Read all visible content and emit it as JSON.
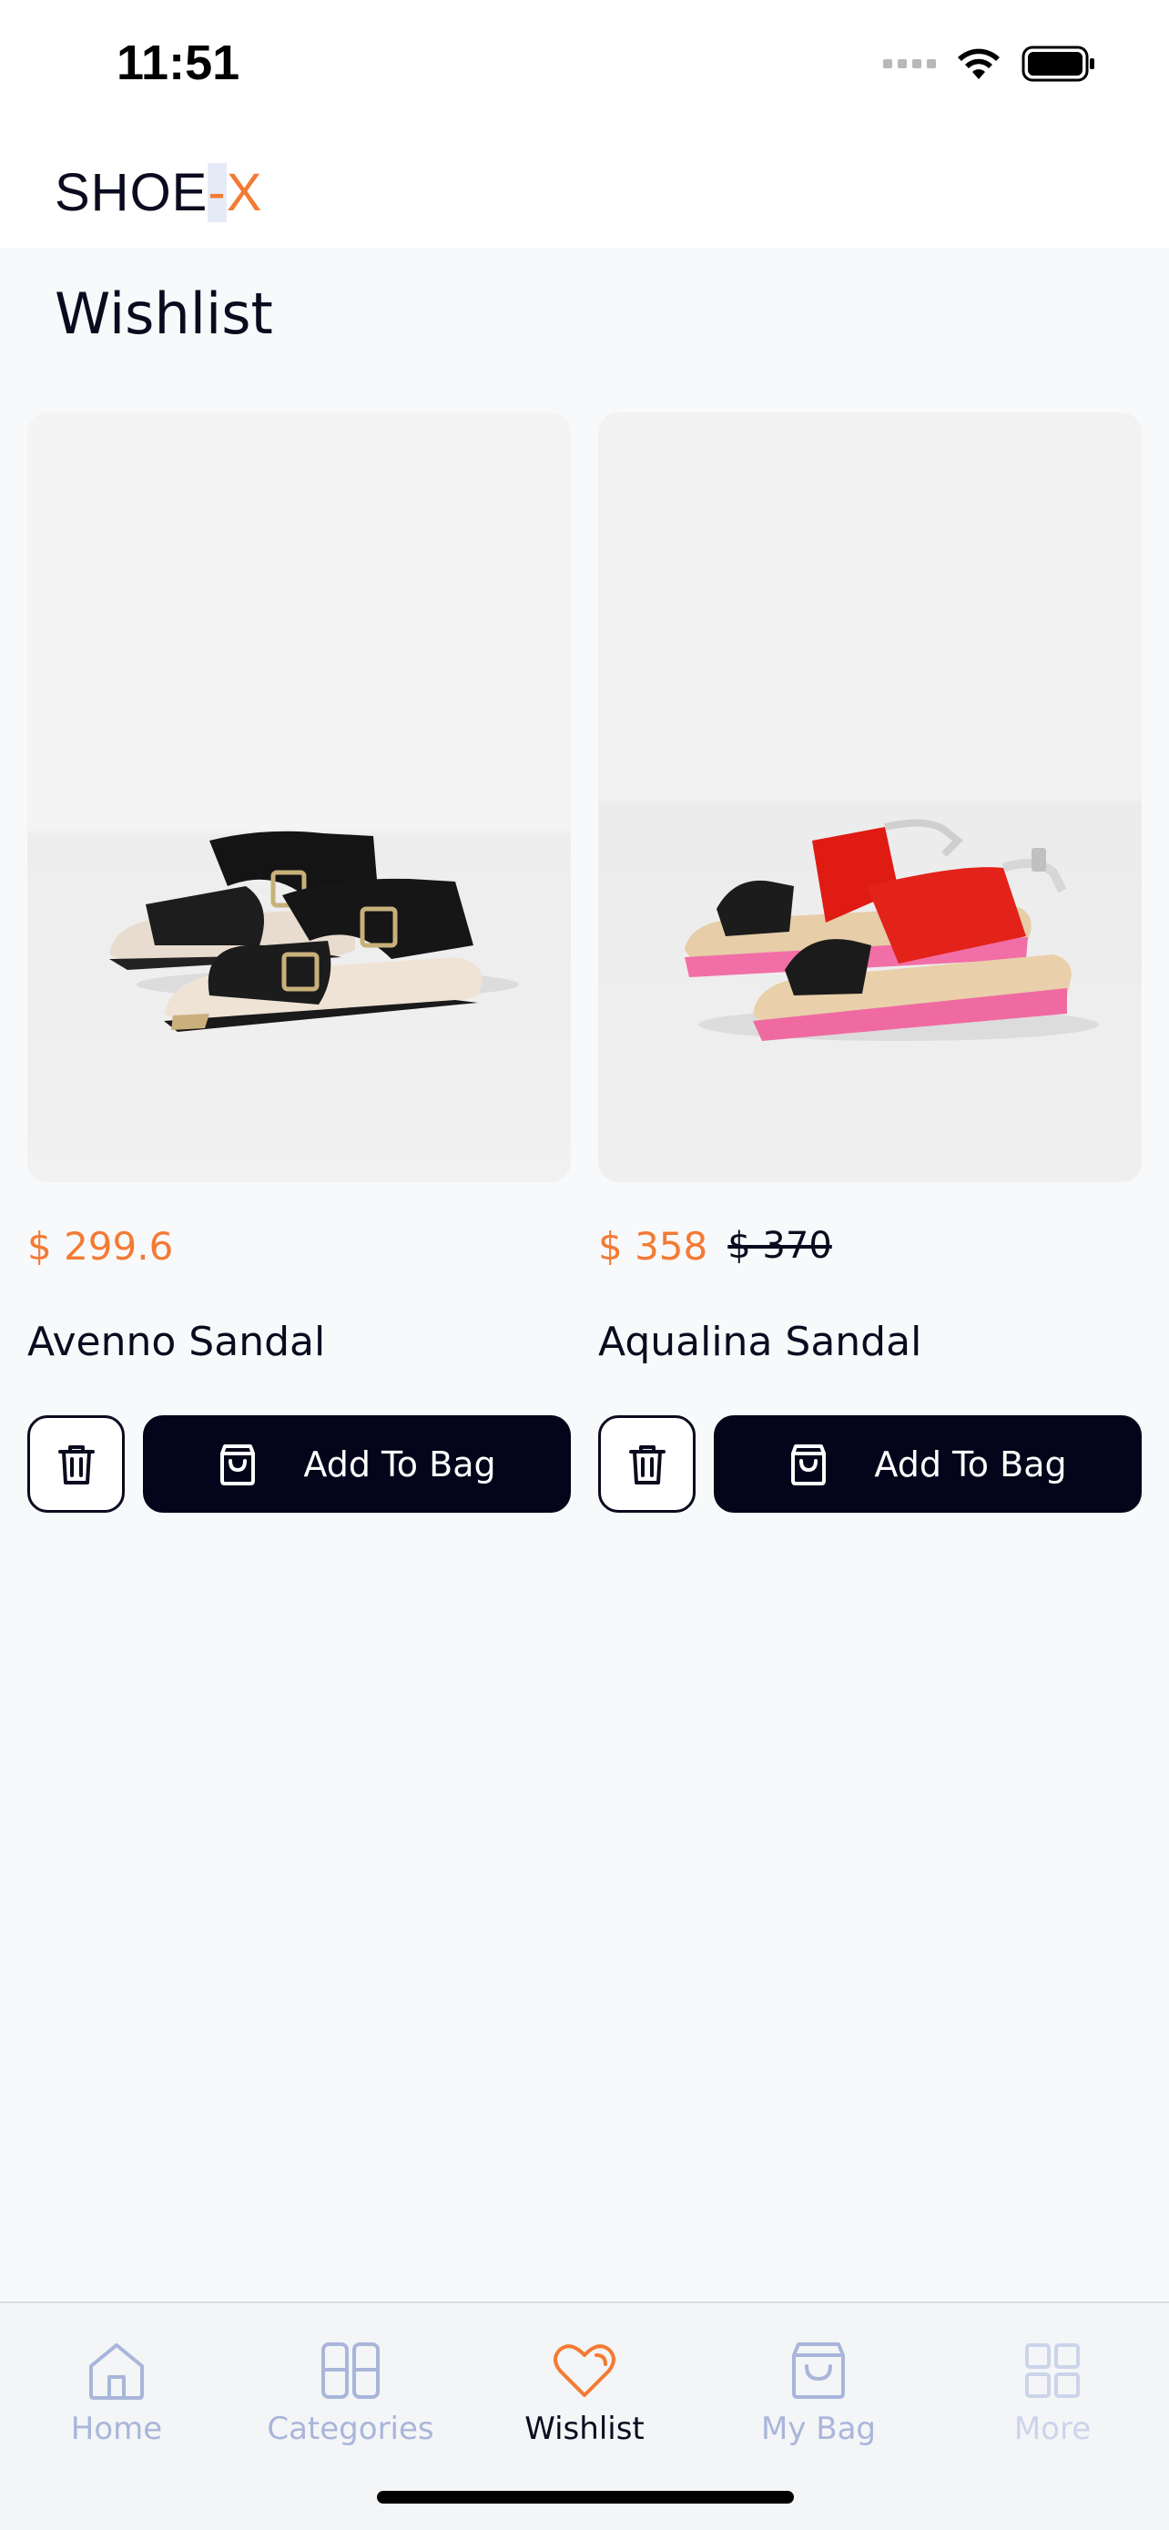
{
  "status_bar": {
    "time": "11:51"
  },
  "header": {
    "logo_main": "SHOE",
    "logo_dash": "-",
    "logo_accent": "X"
  },
  "page": {
    "title": "Wishlist"
  },
  "products": [
    {
      "price": "$ 299.6",
      "old_price": "",
      "name": "Avenno Sandal",
      "add_label": "Add To Bag"
    },
    {
      "price": "$ 358",
      "old_price": "$ 370",
      "name": "Aqualina Sandal",
      "add_label": "Add To Bag"
    }
  ],
  "tab_bar": {
    "tabs": [
      {
        "label": "Home",
        "icon": "home-icon"
      },
      {
        "label": "Categories",
        "icon": "categories-icon"
      },
      {
        "label": "Wishlist",
        "icon": "heart-icon",
        "active": true
      },
      {
        "label": "My Bag",
        "icon": "bag-icon"
      },
      {
        "label": "More",
        "icon": "grid-icon"
      }
    ]
  },
  "colors": {
    "accent": "#f47a34",
    "dark": "#04041a",
    "inactive_tab": "#a9b6da",
    "background": "#f8f9fa"
  }
}
